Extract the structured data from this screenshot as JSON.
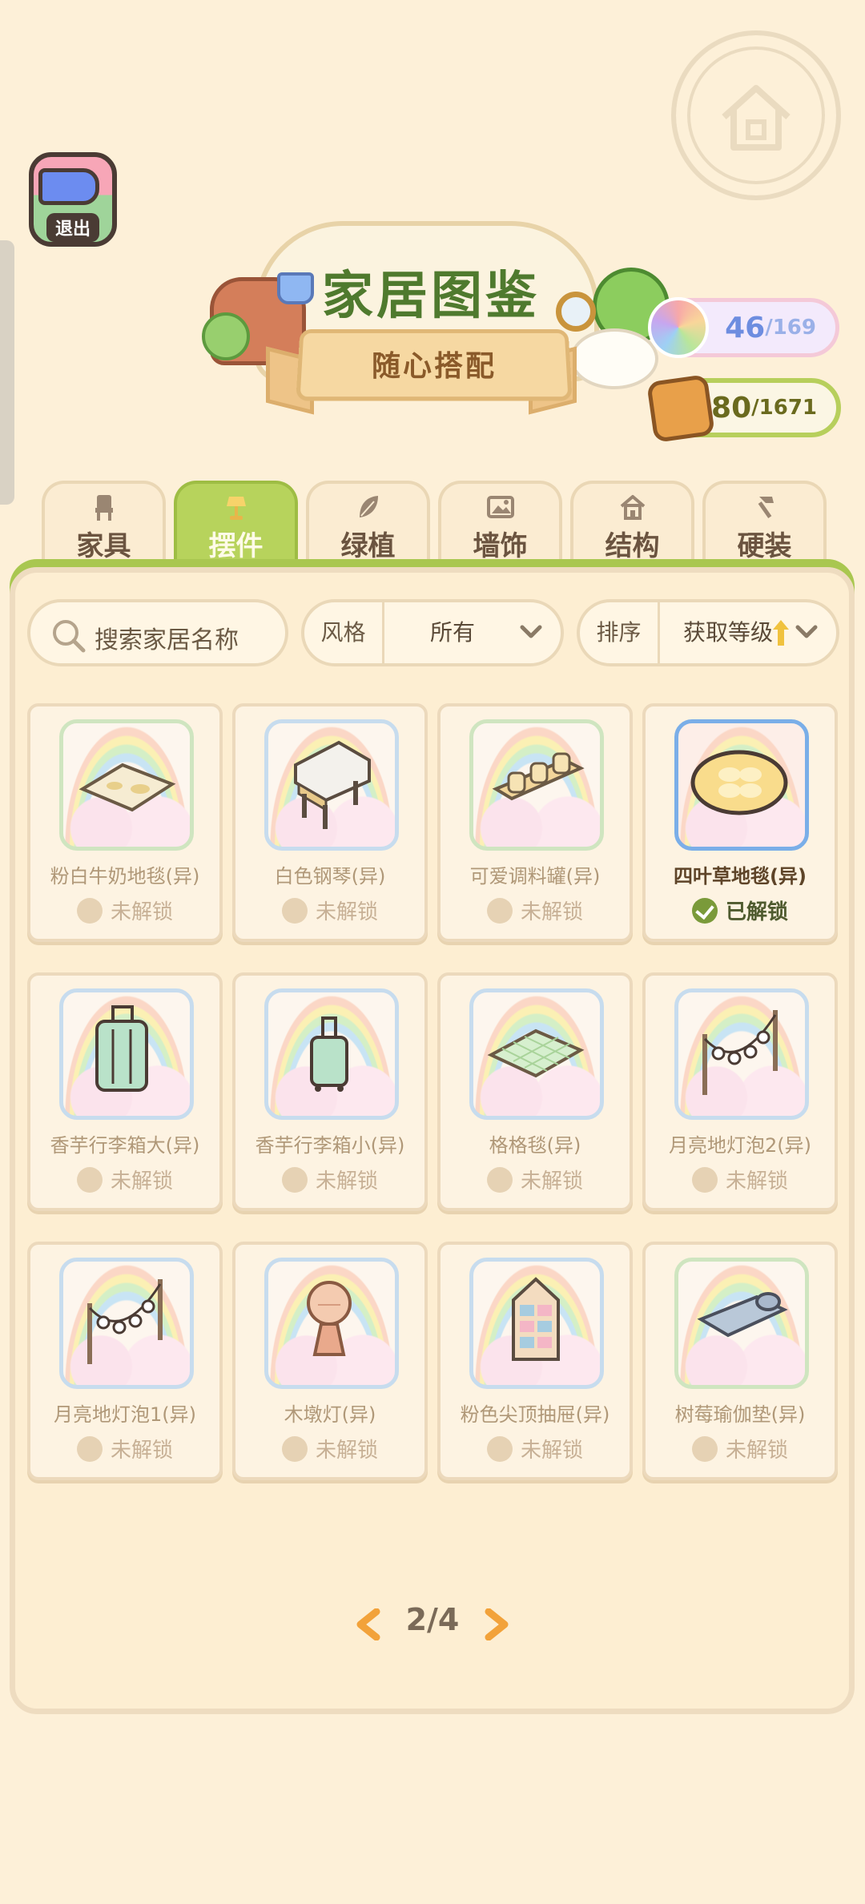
{
  "header": {
    "exit_label": "退出",
    "title": "家居图鉴",
    "subtitle": "随心搭配",
    "rainbow_counter": {
      "current": "46",
      "total": "/169"
    },
    "book_counter": {
      "current": "580",
      "total": "/1671"
    }
  },
  "tabs": [
    {
      "label": "家具",
      "icon": "chair-icon",
      "active": false
    },
    {
      "label": "摆件",
      "icon": "lamp-icon",
      "active": true
    },
    {
      "label": "绿植",
      "icon": "leaf-icon",
      "active": false
    },
    {
      "label": "墙饰",
      "icon": "picture-icon",
      "active": false
    },
    {
      "label": "结构",
      "icon": "house-icon",
      "active": false
    },
    {
      "label": "硬装",
      "icon": "hammer-icon",
      "active": false
    }
  ],
  "filters": {
    "search_placeholder": "搜索家居名称",
    "style_label": "风格",
    "style_value": "所有",
    "sort_label": "排序",
    "sort_value": "获取等级"
  },
  "items": [
    {
      "name": "粉白牛奶地毯(异)",
      "status": "未解锁",
      "unlocked": false,
      "icon": "rug-icon"
    },
    {
      "name": "白色钢琴(异)",
      "status": "未解锁",
      "unlocked": false,
      "icon": "piano-icon"
    },
    {
      "name": "可爱调料罐(异)",
      "status": "未解锁",
      "unlocked": false,
      "icon": "jars-icon"
    },
    {
      "name": "四叶草地毯(异)",
      "status": "已解锁",
      "unlocked": true,
      "icon": "clover-rug-icon"
    },
    {
      "name": "香芋行李箱大(异)",
      "status": "未解锁",
      "unlocked": false,
      "icon": "suitcase-large-icon"
    },
    {
      "name": "香芋行李箱小(异)",
      "status": "未解锁",
      "unlocked": false,
      "icon": "suitcase-small-icon"
    },
    {
      "name": "格格毯(异)",
      "status": "未解锁",
      "unlocked": false,
      "icon": "grid-rug-icon"
    },
    {
      "name": "月亮地灯泡2(异)",
      "status": "未解锁",
      "unlocked": false,
      "icon": "string-lights-icon"
    },
    {
      "name": "月亮地灯泡1(异)",
      "status": "未解锁",
      "unlocked": false,
      "icon": "string-lights-icon"
    },
    {
      "name": "木墩灯(异)",
      "status": "未解锁",
      "unlocked": false,
      "icon": "stump-lamp-icon"
    },
    {
      "name": "粉色尖顶抽屉(异)",
      "status": "未解锁",
      "unlocked": false,
      "icon": "drawer-icon"
    },
    {
      "name": "树莓瑜伽垫(异)",
      "status": "未解锁",
      "unlocked": false,
      "icon": "yoga-mat-icon"
    }
  ],
  "pagination": {
    "text": "2/4"
  }
}
